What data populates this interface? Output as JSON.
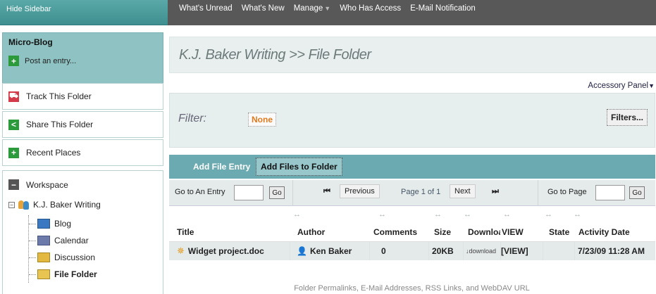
{
  "sidebar": {
    "hide_label": "Hide Sidebar",
    "microblog": {
      "title": "Micro-Blog",
      "post_label": "Post an entry..."
    },
    "boxes": [
      {
        "label": "Track This Folder",
        "icon": "track-icon"
      },
      {
        "label": "Share This Folder",
        "icon": "share-icon"
      },
      {
        "label": "Recent Places",
        "icon": "plus-icon"
      }
    ],
    "workspace": {
      "label": "Workspace",
      "root": "K.J. Baker Writing",
      "children": [
        "Blog",
        "Calendar",
        "Discussion",
        "File Folder"
      ]
    }
  },
  "nav": {
    "items": [
      "What's Unread",
      "What's New",
      "Manage",
      "Who Has Access",
      "E-Mail Notification"
    ]
  },
  "main": {
    "title": "K.J. Baker Writing >> File Folder",
    "accessory_panel": "Accessory Panel",
    "filter": {
      "label": "Filter:",
      "value": "None",
      "button": "Filters..."
    },
    "tabs": [
      "Add File Entry",
      "Add Files to Folder"
    ],
    "pager": {
      "goto_entry": "Go to An Entry",
      "go": "Go",
      "previous": "Previous",
      "page_info": "Page 1 of 1",
      "next": "Next",
      "goto_page": "Go to Page"
    },
    "table": {
      "sort_glyph": "↔",
      "headers": [
        "Title",
        "Author",
        "Comments",
        "Size",
        "Downloads",
        "VIEW",
        "State",
        "Activity Date"
      ],
      "rows": [
        {
          "title": "Widget project.doc",
          "author": "Ken Baker",
          "comments": "0",
          "size": "20KB",
          "download": "download",
          "view": "[VIEW]",
          "state": "",
          "date": "7/23/09 11:28 AM"
        }
      ]
    },
    "footer": "Folder Permalinks, E-Mail Addresses, RSS Links, and WebDAV URL"
  }
}
